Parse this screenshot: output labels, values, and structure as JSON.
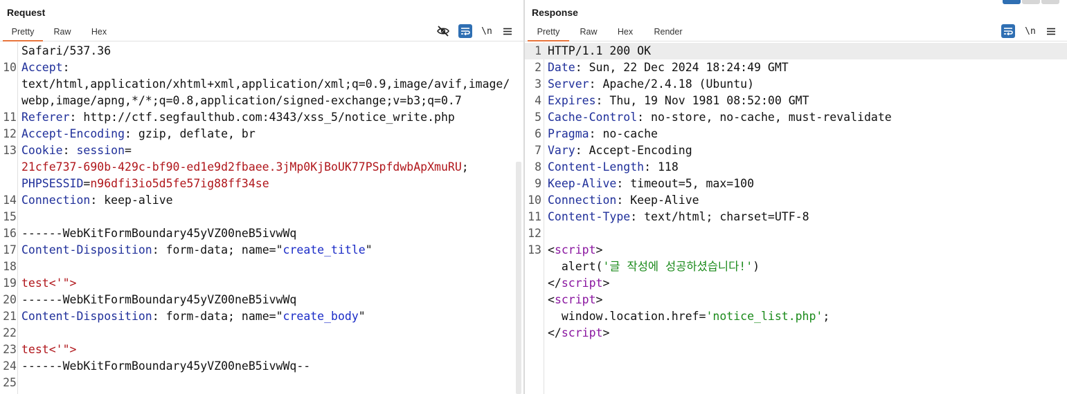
{
  "colors": {
    "accent": "#2f6fb3",
    "tab_underline": "#e8743b",
    "header_key": "#1f2f9a",
    "cookie_value": "#b0161b",
    "string_blue": "#1a2bc7",
    "string_green": "#1a8a1a",
    "html_tag": "#8a16a0"
  },
  "request": {
    "title": "Request",
    "tabs": [
      "Pretty",
      "Raw",
      "Hex"
    ],
    "active_tab": "Pretty",
    "toolbar": {
      "hide_icon": "eye-slash-icon",
      "wrap_icon": "wrap-lines-icon",
      "newline_label": "\\n",
      "menu_icon": "hamburger-menu-icon"
    },
    "lines": [
      {
        "num": "",
        "parts": [
          {
            "c": "v",
            "t": "Safari/537.36"
          }
        ]
      },
      {
        "num": "10",
        "parts": [
          {
            "c": "k",
            "t": "Accept"
          },
          {
            "c": "p",
            "t": ":"
          }
        ]
      },
      {
        "num": "",
        "parts": [
          {
            "c": "v",
            "t": "text/html,application/xhtml+xml,application/xml;q=0.9,image/avif,image/"
          }
        ]
      },
      {
        "num": "",
        "parts": [
          {
            "c": "v",
            "t": "webp,image/apng,*/*;q=0.8,application/signed-exchange;v=b3;q=0.7"
          }
        ]
      },
      {
        "num": "11",
        "parts": [
          {
            "c": "k",
            "t": "Referer"
          },
          {
            "c": "p",
            "t": ": "
          },
          {
            "c": "v",
            "t": "http://ctf.segfaulthub.com:4343/xss_5/notice_write.php"
          }
        ]
      },
      {
        "num": "12",
        "parts": [
          {
            "c": "k",
            "t": "Accept-Encoding"
          },
          {
            "c": "p",
            "t": ": "
          },
          {
            "c": "v",
            "t": "gzip, deflate, br"
          }
        ]
      },
      {
        "num": "13",
        "parts": [
          {
            "c": "k",
            "t": "Cookie"
          },
          {
            "c": "p",
            "t": ": "
          },
          {
            "c": "k",
            "t": "session"
          },
          {
            "c": "p",
            "t": "="
          }
        ]
      },
      {
        "num": "",
        "parts": [
          {
            "c": "r",
            "t": "21cfe737-690b-429c-bf90-ed1e9d2fbaee.3jMp0KjBoUK77PSpfdwbApXmuRU"
          },
          {
            "c": "p",
            "t": ";"
          }
        ]
      },
      {
        "num": "",
        "parts": [
          {
            "c": "k",
            "t": "PHPSESSID"
          },
          {
            "c": "p",
            "t": "="
          },
          {
            "c": "r",
            "t": "n96dfi3io5d5fe57ig88ff34se"
          }
        ]
      },
      {
        "num": "14",
        "parts": [
          {
            "c": "k",
            "t": "Connection"
          },
          {
            "c": "p",
            "t": ": "
          },
          {
            "c": "v",
            "t": "keep-alive"
          }
        ]
      },
      {
        "num": "15",
        "parts": []
      },
      {
        "num": "16",
        "parts": [
          {
            "c": "v",
            "t": "------WebKitFormBoundary45yVZ00neB5ivwWq"
          }
        ]
      },
      {
        "num": "17",
        "parts": [
          {
            "c": "k",
            "t": "Content-Disposition"
          },
          {
            "c": "p",
            "t": ": "
          },
          {
            "c": "v",
            "t": "form-data; name=\""
          },
          {
            "c": "s",
            "t": "create_title"
          },
          {
            "c": "v",
            "t": "\""
          }
        ]
      },
      {
        "num": "18",
        "parts": []
      },
      {
        "num": "19",
        "parts": [
          {
            "c": "r",
            "t": "test<'\">"
          }
        ]
      },
      {
        "num": "20",
        "parts": [
          {
            "c": "v",
            "t": "------WebKitFormBoundary45yVZ00neB5ivwWq"
          }
        ]
      },
      {
        "num": "21",
        "parts": [
          {
            "c": "k",
            "t": "Content-Disposition"
          },
          {
            "c": "p",
            "t": ": "
          },
          {
            "c": "v",
            "t": "form-data; name=\""
          },
          {
            "c": "s",
            "t": "create_body"
          },
          {
            "c": "v",
            "t": "\""
          }
        ]
      },
      {
        "num": "22",
        "parts": []
      },
      {
        "num": "23",
        "parts": [
          {
            "c": "r",
            "t": "test<'\">"
          }
        ]
      },
      {
        "num": "24",
        "parts": [
          {
            "c": "v",
            "t": "------WebKitFormBoundary45yVZ00neB5ivwWq--"
          }
        ]
      },
      {
        "num": "25",
        "parts": []
      }
    ]
  },
  "response": {
    "title": "Response",
    "tabs": [
      "Pretty",
      "Raw",
      "Hex",
      "Render"
    ],
    "active_tab": "Pretty",
    "toolbar": {
      "wrap_icon": "wrap-lines-icon",
      "newline_label": "\\n",
      "menu_icon": "hamburger-menu-icon"
    },
    "lines": [
      {
        "num": "1",
        "hl": true,
        "parts": [
          {
            "c": "v",
            "t": "HTTP/1.1 200 OK"
          }
        ]
      },
      {
        "num": "2",
        "parts": [
          {
            "c": "k",
            "t": "Date"
          },
          {
            "c": "p",
            "t": ": "
          },
          {
            "c": "v",
            "t": "Sun, 22 Dec 2024 18:24:49 GMT"
          }
        ]
      },
      {
        "num": "3",
        "parts": [
          {
            "c": "k",
            "t": "Server"
          },
          {
            "c": "p",
            "t": ": "
          },
          {
            "c": "v",
            "t": "Apache/2.4.18 (Ubuntu)"
          }
        ]
      },
      {
        "num": "4",
        "parts": [
          {
            "c": "k",
            "t": "Expires"
          },
          {
            "c": "p",
            "t": ": "
          },
          {
            "c": "v",
            "t": "Thu, 19 Nov 1981 08:52:00 GMT"
          }
        ]
      },
      {
        "num": "5",
        "parts": [
          {
            "c": "k",
            "t": "Cache-Control"
          },
          {
            "c": "p",
            "t": ": "
          },
          {
            "c": "v",
            "t": "no-store, no-cache, must-revalidate"
          }
        ]
      },
      {
        "num": "6",
        "parts": [
          {
            "c": "k",
            "t": "Pragma"
          },
          {
            "c": "p",
            "t": ": "
          },
          {
            "c": "v",
            "t": "no-cache"
          }
        ]
      },
      {
        "num": "7",
        "parts": [
          {
            "c": "k",
            "t": "Vary"
          },
          {
            "c": "p",
            "t": ": "
          },
          {
            "c": "v",
            "t": "Accept-Encoding"
          }
        ]
      },
      {
        "num": "8",
        "parts": [
          {
            "c": "k",
            "t": "Content-Length"
          },
          {
            "c": "p",
            "t": ": "
          },
          {
            "c": "v",
            "t": "118"
          }
        ]
      },
      {
        "num": "9",
        "parts": [
          {
            "c": "k",
            "t": "Keep-Alive"
          },
          {
            "c": "p",
            "t": ": "
          },
          {
            "c": "v",
            "t": "timeout=5, max=100"
          }
        ]
      },
      {
        "num": "10",
        "parts": [
          {
            "c": "k",
            "t": "Connection"
          },
          {
            "c": "p",
            "t": ": "
          },
          {
            "c": "v",
            "t": "Keep-Alive"
          }
        ]
      },
      {
        "num": "11",
        "parts": [
          {
            "c": "k",
            "t": "Content-Type"
          },
          {
            "c": "p",
            "t": ": "
          },
          {
            "c": "v",
            "t": "text/html; charset=UTF-8"
          }
        ]
      },
      {
        "num": "12",
        "parts": []
      },
      {
        "num": "13",
        "parts": [
          {
            "c": "p",
            "t": "<"
          },
          {
            "c": "t",
            "t": "script"
          },
          {
            "c": "p",
            "t": ">"
          }
        ]
      },
      {
        "num": "",
        "parts": [
          {
            "c": "v",
            "t": "  alert("
          },
          {
            "c": "g",
            "t": "'글 작성에 성공하셨습니다!'"
          },
          {
            "c": "v",
            "t": ")"
          }
        ]
      },
      {
        "num": "",
        "parts": [
          {
            "c": "p",
            "t": "</"
          },
          {
            "c": "t",
            "t": "script"
          },
          {
            "c": "p",
            "t": ">"
          }
        ]
      },
      {
        "num": "",
        "parts": [
          {
            "c": "p",
            "t": "<"
          },
          {
            "c": "t",
            "t": "script"
          },
          {
            "c": "p",
            "t": ">"
          }
        ]
      },
      {
        "num": "",
        "parts": [
          {
            "c": "v",
            "t": "  window.location.href="
          },
          {
            "c": "g",
            "t": "'notice_list.php'"
          },
          {
            "c": "v",
            "t": ";"
          }
        ]
      },
      {
        "num": "",
        "parts": [
          {
            "c": "p",
            "t": "</"
          },
          {
            "c": "t",
            "t": "script"
          },
          {
            "c": "p",
            "t": ">"
          }
        ]
      }
    ]
  }
}
